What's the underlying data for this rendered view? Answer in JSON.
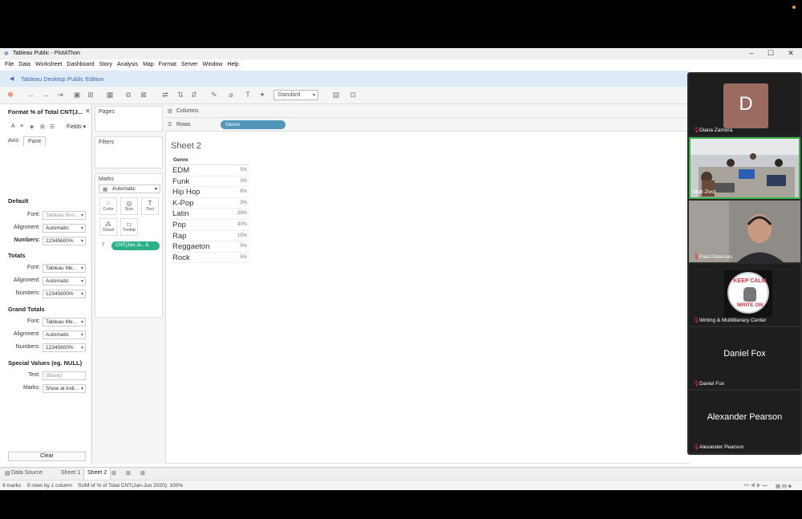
{
  "window": {
    "title": "Tableau Public - PlotAThon"
  },
  "menu": [
    "File",
    "Data",
    "Worksheet",
    "Dashboard",
    "Story",
    "Analysis",
    "Map",
    "Format",
    "Server",
    "Window",
    "Help"
  ],
  "banner": {
    "text": "Tableau Desktop Public Edition"
  },
  "toolbar": {
    "fit_select": "Standard"
  },
  "format_pane": {
    "title": "Format % of Total CNT(J...",
    "fields_label": "Fields",
    "tabs": [
      "Axis",
      "Pane"
    ],
    "sections": {
      "default": {
        "title": "Default",
        "font_label": "Font:",
        "font": "Tableau Boo...",
        "align_label": "Alignment:",
        "align": "Automatic",
        "num_label": "Numbers:",
        "num": "12345600%"
      },
      "totals": {
        "title": "Totals",
        "font_label": "Font:",
        "font": "Tableau Me...",
        "align_label": "Alignment:",
        "align": "Automatic",
        "num_label": "Numbers:",
        "num": "12345600%"
      },
      "grand": {
        "title": "Grand Totals",
        "font_label": "Font:",
        "font": "Tableau Me...",
        "align_label": "Alignment:",
        "align": "Automatic",
        "num_label": "Numbers:",
        "num": "12345600%"
      },
      "special": {
        "title": "Special Values (eg. NULL)",
        "text_label": "Text:",
        "text_placeholder": "(Blank)",
        "marks_label": "Marks:",
        "marks": "Show at Indi..."
      }
    },
    "clear": "Clear"
  },
  "cards": {
    "pages": "Pages",
    "filters": "Filters",
    "marks": "Marks",
    "mark_type": "Automatic",
    "buttons": [
      "Color",
      "Size",
      "Text",
      "Detail",
      "Tooltip"
    ],
    "pill": "CNT(Jan-Ju.. Δ"
  },
  "shelves": {
    "columns": "Columns",
    "rows": "Rows",
    "row_pill": "Genre"
  },
  "sheet": {
    "title": "Sheet 2",
    "header": "Genre",
    "rows": [
      {
        "genre": "EDM",
        "pct": "5%"
      },
      {
        "genre": "Funk",
        "pct": "3%"
      },
      {
        "genre": "Hip Hop",
        "pct": "8%"
      },
      {
        "genre": "K-Pop",
        "pct": "3%"
      },
      {
        "genre": "Latin",
        "pct": "28%"
      },
      {
        "genre": "Pop",
        "pct": "30%"
      },
      {
        "genre": "Rap",
        "pct": "15%"
      },
      {
        "genre": "Reggaeton",
        "pct": "5%"
      },
      {
        "genre": "Rock",
        "pct": "5%"
      }
    ]
  },
  "tabs": {
    "data_source": "Data Source",
    "sheet1": "Sheet 1",
    "sheet2": "Sheet 2"
  },
  "status": {
    "marks": "9 marks",
    "dims": "9 rows by 1 column",
    "sum": "SUM of % of Total CNT(Jan-Jun 2020): 100%"
  },
  "participants": [
    {
      "name": "Diana Zamora",
      "initial": "D"
    },
    {
      "name": "Matt Zivot"
    },
    {
      "name": "Paul Peterson"
    },
    {
      "name": "Writing & Multiliteracy Center",
      "logo_top": "KEEP CALM",
      "logo_bottom": "WRITE ON"
    },
    {
      "name": "Daniel Fox"
    },
    {
      "name": "Alexander Pearson"
    }
  ]
}
